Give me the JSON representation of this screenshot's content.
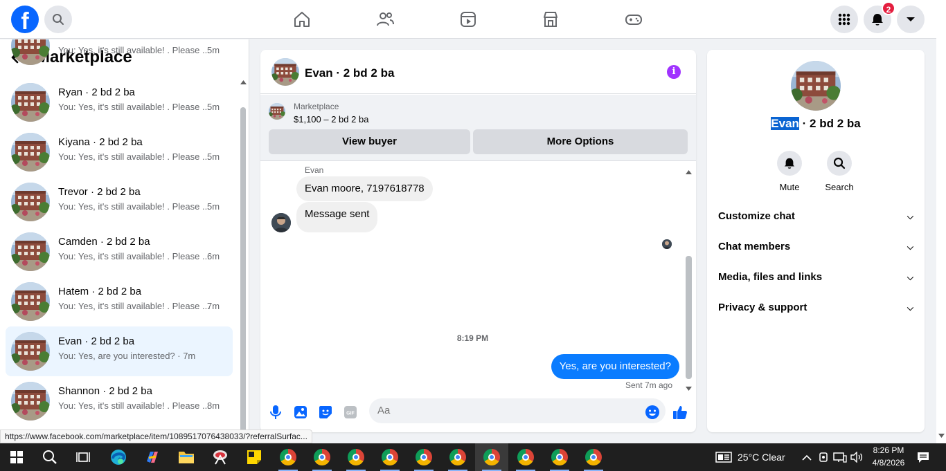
{
  "topnav": {
    "logo": "f",
    "notifications_badge": "2",
    "icons": [
      "facebook-logo",
      "search-icon",
      "home-icon",
      "friends-icon",
      "video-icon",
      "marketplace-icon",
      "gaming-icon",
      "menu-grid-icon",
      "bell-icon",
      "account-dropdown-icon"
    ]
  },
  "sidebar": {
    "title": "Marketplace",
    "conversations": [
      {
        "name": "",
        "preview": "You: Yes, it's still available! . Please ...",
        "time": "5m"
      },
      {
        "name": "Ryan · 2 bd 2 ba",
        "preview": "You: Yes, it's still available! . Please ...",
        "time": "5m"
      },
      {
        "name": "Kiyana · 2 bd 2 ba",
        "preview": "You: Yes, it's still available! . Please ...",
        "time": "5m"
      },
      {
        "name": "Trevor · 2 bd 2 ba",
        "preview": "You: Yes, it's still available! . Please ...",
        "time": "5m"
      },
      {
        "name": "Camden · 2 bd 2 ba",
        "preview": "You: Yes, it's still available! . Please ...",
        "time": "6m"
      },
      {
        "name": "Hatem · 2 bd 2 ba",
        "preview": "You: Yes, it's still available! . Please ...",
        "time": "7m"
      },
      {
        "name": "Evan · 2 bd 2 ba",
        "preview": "You: Yes, are you interested? · 7m",
        "time": ""
      },
      {
        "name": "Shannon · 2 bd 2 ba",
        "preview": "You: Yes, it's still available! . Please ...",
        "time": "8m"
      }
    ]
  },
  "chat": {
    "title": "Evan · 2 bd 2 ba",
    "marketplace_label": "Marketplace",
    "listing": "$1,100 – 2 bd 2 ba",
    "view_buyer": "View buyer",
    "more_options": "More Options",
    "sender_name": "Evan",
    "incoming": [
      "Evan moore, 7197618778",
      "Message sent"
    ],
    "timestamp": "8:19 PM",
    "outgoing": "Yes, are you interested?",
    "sent_status": "Sent 7m ago",
    "composer_placeholder": "Aa"
  },
  "info_panel": {
    "name_highlight": "Evan",
    "name_rest": " · 2 bd 2 ba",
    "actions": [
      "Mute",
      "Search"
    ],
    "sections": [
      "Customize chat",
      "Chat members",
      "Media, files and links",
      "Privacy & support"
    ]
  },
  "status_url": "https://www.facebook.com/marketplace/item/1089517076438033/?referralSurfac...",
  "taskbar": {
    "weather": "25°C  Clear",
    "time": "8:26 PM",
    "date": "4/8/2026"
  },
  "colors": {
    "accent": "#0866ff",
    "bubble_out": "#0a7cff",
    "badge": "#e41e3f",
    "info_icon": "#a033ff"
  }
}
